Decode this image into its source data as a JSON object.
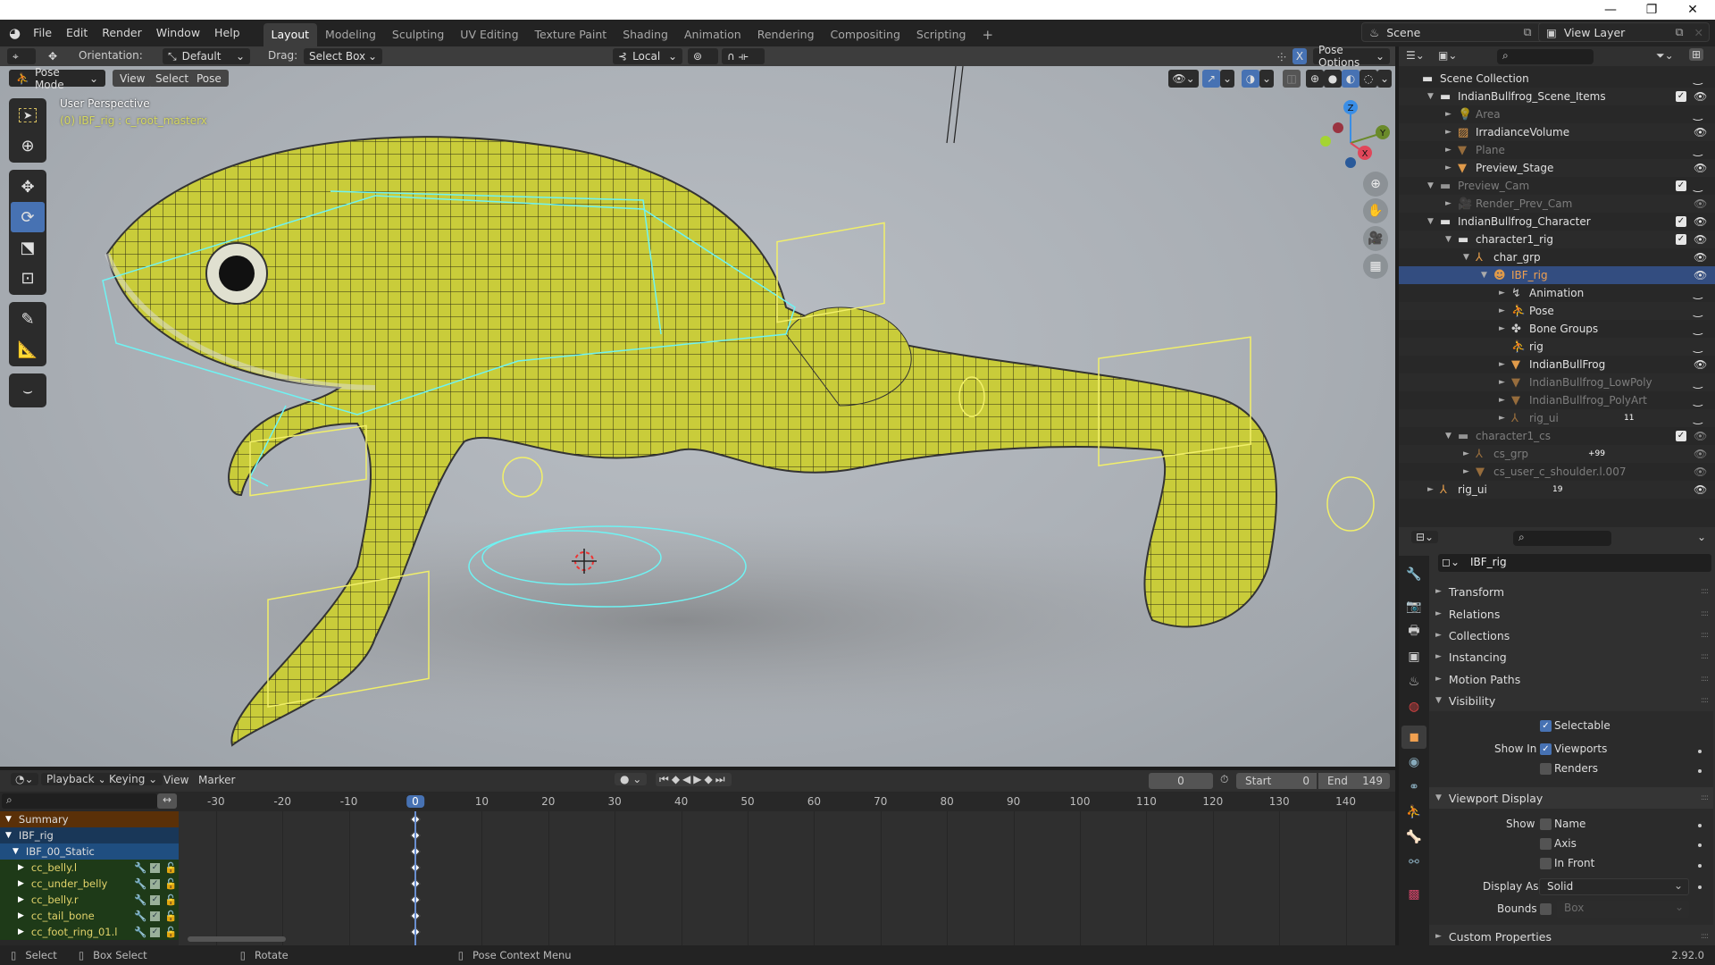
{
  "window": {
    "minimize_icon": "—",
    "maximize_icon": "❐",
    "close_icon": "✕"
  },
  "menu": {
    "items": [
      "File",
      "Edit",
      "Render",
      "Window",
      "Help"
    ]
  },
  "workspaces": {
    "tabs": [
      "Layout",
      "Modeling",
      "Sculpting",
      "UV Editing",
      "Texture Paint",
      "Shading",
      "Animation",
      "Rendering",
      "Compositing",
      "Scripting"
    ],
    "active": "Layout",
    "add": "+"
  },
  "scene": {
    "name": "Scene",
    "view_layer": "View Layer"
  },
  "viewport_header": {
    "orientation_label": "Orientation:",
    "orientation_value": "Default",
    "drag_label": "Drag:",
    "drag_value": "Select Box",
    "pivot_value": "Local",
    "mirror_x": "X",
    "pose_options": "Pose Options"
  },
  "viewport_sub": {
    "mode": "Pose Mode",
    "menus": [
      "View",
      "Select",
      "Pose"
    ]
  },
  "viewport": {
    "perspective": "User Perspective",
    "active_info": "(0) IBF_rig : c_root_masterx",
    "gizmo": {
      "z": "Z",
      "y": "Y",
      "x": "X"
    }
  },
  "tools": [
    "select-box",
    "cursor",
    "move",
    "rotate",
    "scale",
    "transform",
    "annotate",
    "measure",
    "bone-relax"
  ],
  "active_tool": "rotate",
  "outliner": {
    "rows": [
      {
        "label": "Scene Collection",
        "depth": 0,
        "icon": "collection",
        "arrow": "",
        "dim": false,
        "check": false,
        "eye": false
      },
      {
        "label": "IndianBullfrog_Scene_Items",
        "depth": 1,
        "icon": "collection",
        "arrow": "▼",
        "dim": false,
        "check": true,
        "eye": true
      },
      {
        "label": "Area",
        "depth": 2,
        "icon": "light",
        "arrow": "►",
        "dim": true,
        "check": false,
        "eye": false
      },
      {
        "label": "IrradianceVolume",
        "depth": 2,
        "icon": "lightprobe",
        "arrow": "►",
        "dim": false,
        "check": false,
        "eye": true
      },
      {
        "label": "Plane",
        "depth": 2,
        "icon": "mesh",
        "arrow": "►",
        "dim": true,
        "check": false,
        "eye": false
      },
      {
        "label": "Preview_Stage",
        "depth": 2,
        "icon": "mesh",
        "arrow": "►",
        "dim": false,
        "check": false,
        "eye": true
      },
      {
        "label": "Preview_Cam",
        "depth": 1,
        "icon": "collection",
        "arrow": "▼",
        "dim": true,
        "check": true,
        "eye": false
      },
      {
        "label": "Render_Prev_Cam",
        "depth": 2,
        "icon": "camera",
        "arrow": "►",
        "dim": true,
        "check": false,
        "eye": true
      },
      {
        "label": "IndianBullfrog_Character",
        "depth": 1,
        "icon": "collection",
        "arrow": "▼",
        "dim": false,
        "check": true,
        "eye": true
      },
      {
        "label": "character1_rig",
        "depth": 2,
        "icon": "collection",
        "arrow": "▼",
        "dim": false,
        "check": true,
        "eye": true
      },
      {
        "label": "char_grp",
        "depth": 3,
        "icon": "empty",
        "arrow": "▼",
        "dim": false,
        "check": false,
        "eye": true
      },
      {
        "label": "IBF_rig",
        "depth": 4,
        "icon": "armature",
        "arrow": "▼",
        "dim": false,
        "check": false,
        "eye": true,
        "selected": true
      },
      {
        "label": "Animation",
        "depth": 5,
        "icon": "anim",
        "arrow": "►",
        "dim": false,
        "check": false,
        "eye": false
      },
      {
        "label": "Pose",
        "depth": 5,
        "icon": "pose",
        "arrow": "►",
        "dim": false,
        "check": false,
        "eye": false
      },
      {
        "label": "Bone Groups",
        "depth": 5,
        "icon": "bonegroup",
        "arrow": "►",
        "dim": false,
        "check": false,
        "eye": false
      },
      {
        "label": "rig",
        "depth": 5,
        "icon": "armature-data",
        "arrow": "",
        "dim": false,
        "check": false,
        "eye": false
      },
      {
        "label": "IndianBullFrog",
        "depth": 5,
        "icon": "mesh",
        "arrow": "►",
        "dim": false,
        "check": false,
        "eye": true
      },
      {
        "label": "IndianBullfrog_LowPoly",
        "depth": 5,
        "icon": "mesh",
        "arrow": "►",
        "dim": true,
        "check": false,
        "eye": false
      },
      {
        "label": "IndianBullfrog_PolyArt",
        "depth": 5,
        "icon": "mesh",
        "arrow": "►",
        "dim": true,
        "check": false,
        "eye": false
      },
      {
        "label": "rig_ui",
        "depth": 5,
        "icon": "empty",
        "arrow": "►",
        "dim": true,
        "check": false,
        "eye": false,
        "badge": "11"
      },
      {
        "label": "character1_cs",
        "depth": 2,
        "icon": "collection",
        "arrow": "▼",
        "dim": true,
        "check": true,
        "eye": true
      },
      {
        "label": "cs_grp",
        "depth": 3,
        "icon": "empty",
        "arrow": "►",
        "dim": true,
        "check": false,
        "eye": true,
        "badge": "+99"
      },
      {
        "label": "cs_user_c_shoulder.l.007",
        "depth": 3,
        "icon": "mesh",
        "arrow": "►",
        "dim": true,
        "check": false,
        "eye": true
      },
      {
        "label": "rig_ui",
        "depth": 1,
        "icon": "empty",
        "arrow": "►",
        "dim": false,
        "check": false,
        "eye": true,
        "badge": "19"
      }
    ]
  },
  "properties": {
    "object_name": "IBF_rig",
    "panels": [
      "Transform",
      "Relations",
      "Collections",
      "Instancing",
      "Motion Paths",
      "Visibility"
    ],
    "visibility": {
      "selectable_label": "Selectable",
      "selectable": true,
      "show_in_label": "Show In",
      "viewports_label": "Viewports",
      "viewports": true,
      "renders_label": "Renders",
      "renders": false
    },
    "viewport_display": {
      "title": "Viewport Display",
      "show_label": "Show",
      "name_label": "Name",
      "name": false,
      "axis_label": "Axis",
      "axis": false,
      "in_front_label": "In Front",
      "in_front": false,
      "display_as_label": "Display As",
      "display_as": "Solid",
      "bounds_label": "Bounds",
      "bounds": false,
      "bounds_type": "Box"
    },
    "custom_properties": "Custom Properties"
  },
  "timeline": {
    "menus": [
      "Playback",
      "Keying",
      "View",
      "Marker"
    ],
    "current_frame": "0",
    "start_label": "Start",
    "start": "0",
    "end_label": "End",
    "end": "149",
    "ruler": [
      "-30",
      "-20",
      "-10",
      "0",
      "10",
      "20",
      "30",
      "40",
      "50",
      "60",
      "70",
      "80",
      "90",
      "100",
      "110",
      "120",
      "130",
      "140"
    ],
    "channels": [
      {
        "label": "Summary",
        "type": "summary"
      },
      {
        "label": "IBF_rig",
        "type": "object"
      },
      {
        "label": "IBF_00_Static",
        "type": "action"
      },
      {
        "label": "cc_belly.l",
        "type": "group"
      },
      {
        "label": "cc_under_belly",
        "type": "group"
      },
      {
        "label": "cc_belly.r",
        "type": "group"
      },
      {
        "label": "cc_tail_bone",
        "type": "group"
      },
      {
        "label": "cc_foot_ring_01.l",
        "type": "group"
      }
    ]
  },
  "statusbar": {
    "select": "Select",
    "box_select": "Box Select",
    "rotate": "Rotate",
    "context": "Pose Context Menu",
    "version": "2.92.0"
  }
}
